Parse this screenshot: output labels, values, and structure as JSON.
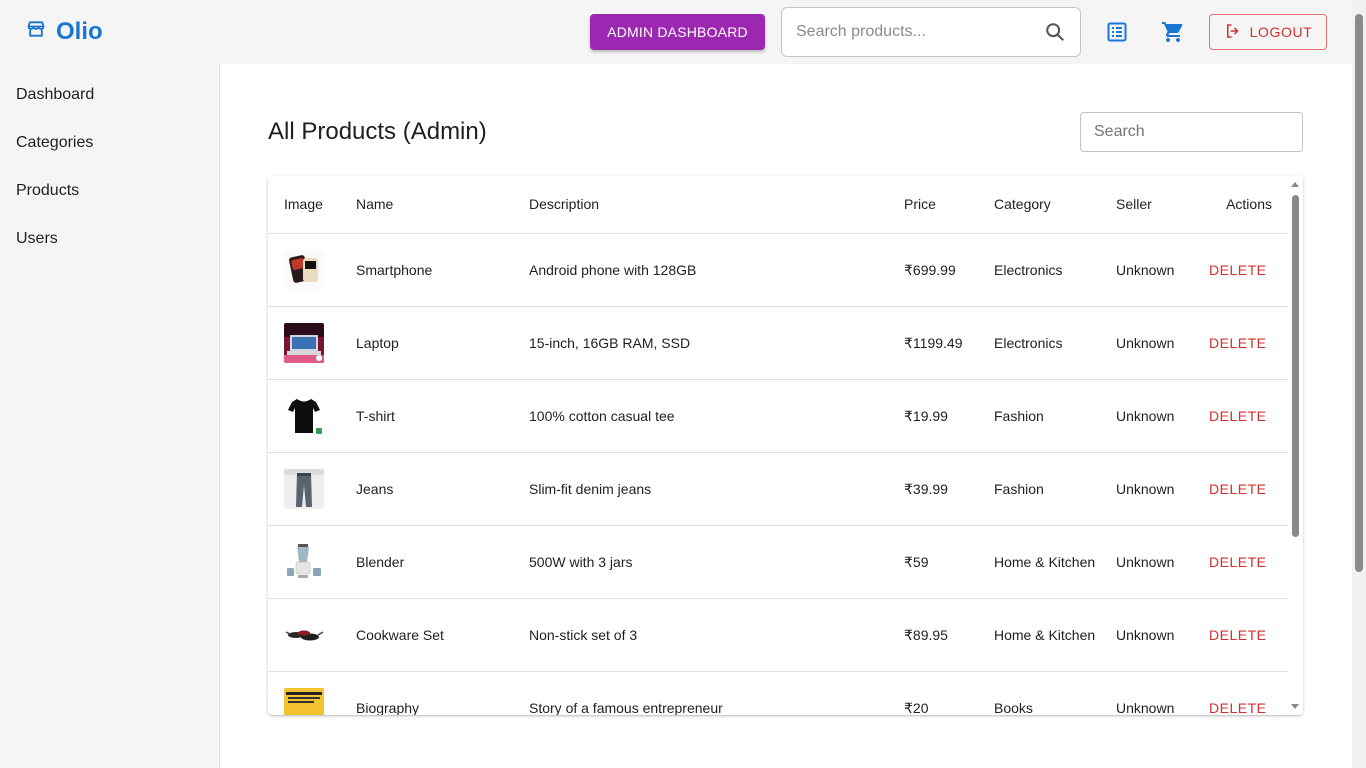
{
  "header": {
    "brand": "Olio",
    "admin_button": "ADMIN DASHBOARD",
    "search_placeholder": "Search products...",
    "logout_label": "LOGOUT",
    "brand_color": "#1976d2",
    "admin_color": "#9c27b0",
    "logout_color": "#d32f2f"
  },
  "sidebar": {
    "items": [
      {
        "label": "Dashboard"
      },
      {
        "label": "Categories"
      },
      {
        "label": "Products"
      },
      {
        "label": "Users"
      }
    ]
  },
  "main": {
    "title": "All Products (Admin)",
    "search_placeholder": "Search",
    "columns": [
      "Image",
      "Name",
      "Description",
      "Price",
      "Category",
      "Seller",
      "Actions"
    ],
    "delete_label": "DELETE",
    "rows": [
      {
        "name": "Smartphone",
        "description": "Android phone with 128GB",
        "price": "₹699.99",
        "category": "Electronics",
        "seller": "Unknown",
        "image": "smartphone-image"
      },
      {
        "name": "Laptop",
        "description": "15-inch, 16GB RAM, SSD",
        "price": "₹1199.49",
        "category": "Electronics",
        "seller": "Unknown",
        "image": "laptop-image"
      },
      {
        "name": "T-shirt",
        "description": "100% cotton casual tee",
        "price": "₹19.99",
        "category": "Fashion",
        "seller": "Unknown",
        "image": "tshirt-image"
      },
      {
        "name": "Jeans",
        "description": "Slim-fit denim jeans",
        "price": "₹39.99",
        "category": "Fashion",
        "seller": "Unknown",
        "image": "jeans-image"
      },
      {
        "name": "Blender",
        "description": "500W with 3 jars",
        "price": "₹59",
        "category": "Home & Kitchen",
        "seller": "Unknown",
        "image": "blender-image"
      },
      {
        "name": "Cookware Set",
        "description": "Non-stick set of 3",
        "price": "₹89.95",
        "category": "Home & Kitchen",
        "seller": "Unknown",
        "image": "cookware-image"
      },
      {
        "name": "Biography",
        "description": "Story of a famous entrepreneur",
        "price": "₹20",
        "category": "Books",
        "seller": "Unknown",
        "image": "book-image"
      }
    ]
  }
}
